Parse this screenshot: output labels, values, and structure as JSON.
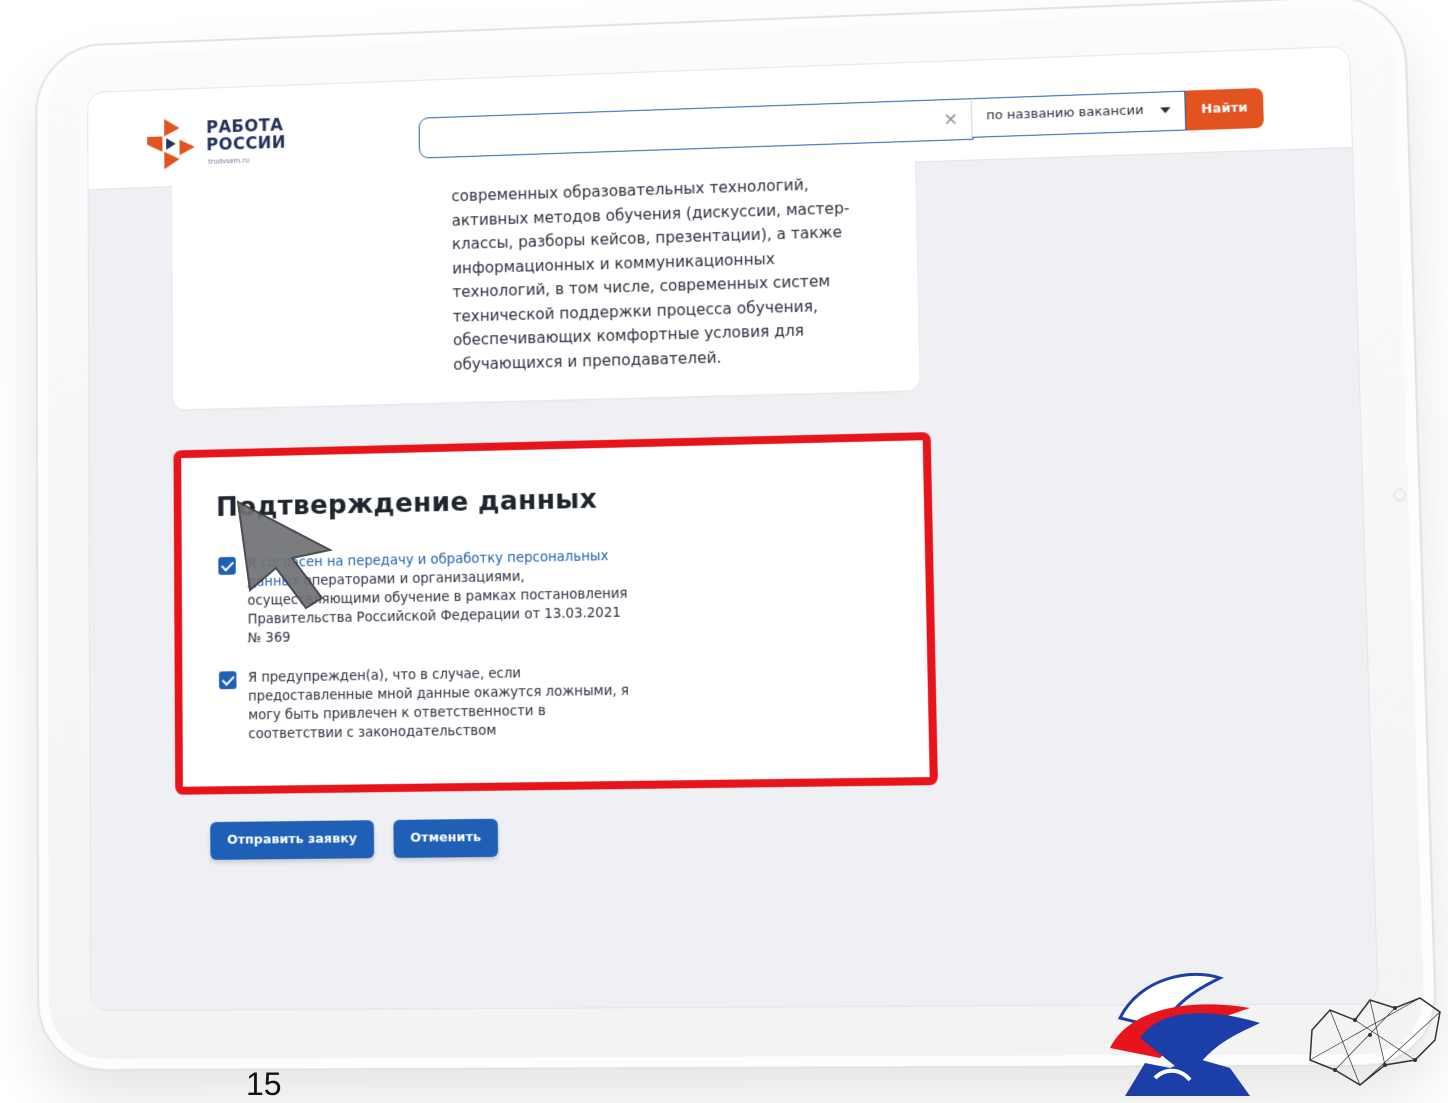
{
  "header": {
    "logo_title_line1": "РАБОТА",
    "logo_title_line2": "РОССИИ",
    "logo_sub": "trudvsem.ru",
    "search_value": "",
    "search_clear": "×",
    "search_mode": "по названию вакансии",
    "search_button": "Найти"
  },
  "description": {
    "text": "современных образовательных технологий, активных методов обучения (дискуссии, мастер-классы, разборы кейсов, презентации), а также информационных и коммуникационных технологий, в том числе, современных систем технической поддержки процесса обучения, обеспечивающих комфортные условия для обучающихся и преподавателей."
  },
  "confirmation": {
    "title": "Подтверждение данных",
    "check1_prefix": "Я ",
    "check1_link": "согласен на передачу и обработку персональных данных",
    "check1_rest": " операторами и организациями, осуществляющими обучение в рамках постановления Правительства Российской Федерации от 13.03.2021 № 369",
    "check1_checked": true,
    "check2_text": "Я предупрежден(а), что в случае, если предоставленные мной данные окажутся ложными, я могу быть привлечен к ответственности в соответствии с законодательством",
    "check2_checked": true
  },
  "actions": {
    "submit_label": "Отправить заявку",
    "cancel_label": "Отменить"
  },
  "footer": {
    "page_number": "15"
  },
  "colors": {
    "accent_blue": "#1f5fb6",
    "search_orange": "#e2531f",
    "highlight_red": "#e8141b"
  }
}
